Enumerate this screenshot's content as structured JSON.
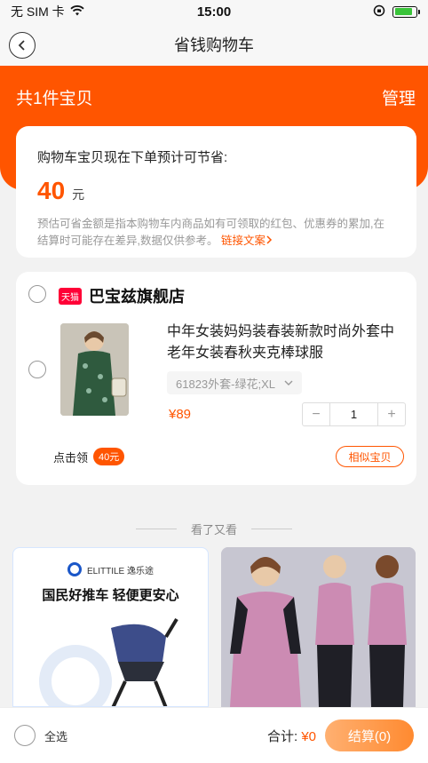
{
  "status_bar": {
    "carrier": "无 SIM 卡",
    "time": "15:00"
  },
  "nav": {
    "title": "省钱购物车"
  },
  "header": {
    "count_label": "共1件宝贝",
    "manage_label": "管理"
  },
  "saving": {
    "title": "购物车宝贝现在下单预计可节省:",
    "amount": "40",
    "unit": "元",
    "desc": "预估可省金额是指本购物车内商品如有可领取的红包、优惠券的累加,在结算时可能存在差异,数据仅供参考。",
    "link": "链接文案"
  },
  "shop": {
    "badge": "天猫",
    "name": "巴宝兹旗舰店",
    "product": {
      "title": "中年女装妈妈装春装新款时尚外套中老年女装春秋夹克棒球服",
      "sku": "61823外套-绿花;XL",
      "price": "¥89",
      "quantity": "1"
    },
    "claim_label": "点击领",
    "claim_amount": "40元",
    "similar_label": "相似宝贝"
  },
  "recommend": {
    "title": "看了又看",
    "cards": [
      {
        "brand": "ELITTILE 逸乐途",
        "slogan": "国民好推车 轻便更安心"
      },
      {
        "brand": "",
        "slogan": ""
      }
    ]
  },
  "bottom": {
    "select_all": "全选",
    "total_label": "合计:",
    "total_value": "¥0",
    "checkout_label": "结算(0)"
  },
  "colors": {
    "accent": "#ff5500",
    "tmall": "#ff0036"
  },
  "battery_level": 0.85
}
